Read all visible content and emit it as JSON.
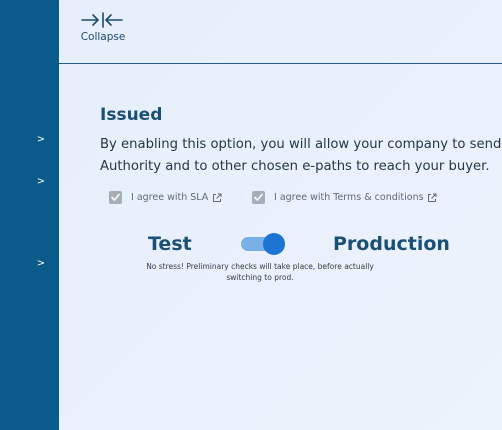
{
  "header": {
    "collapse_label": "Collapse"
  },
  "sidebar": {
    "chevrons": [
      ">",
      ">",
      ">"
    ]
  },
  "section": {
    "title": "Issued",
    "description_line1": "By enabling this option, you will allow your company to send r",
    "description_line2": "Authority and to other chosen e-paths to reach your buyer."
  },
  "agreements": [
    {
      "label": "I agree with SLA",
      "checked": true
    },
    {
      "label": "I agree with Terms & conditions",
      "checked": true
    }
  ],
  "environment": {
    "left_label": "Test",
    "right_label": "Production",
    "toggle_on": true,
    "note_line1": "No stress! Preliminary checks will take place, before actually",
    "note_line2": "switching to prod."
  },
  "colors": {
    "sidebar": "#0a5a8a",
    "accent": "#1e74d4",
    "heading": "#1a4f76"
  }
}
